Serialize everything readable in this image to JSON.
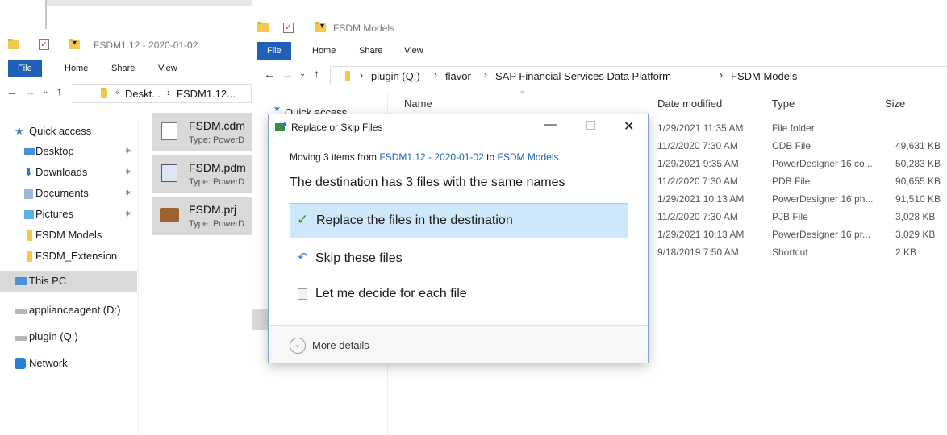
{
  "left_window": {
    "title": "FSDM1.12 - 2020-01-02",
    "tabs": [
      "File",
      "Home",
      "Share",
      "View"
    ],
    "breadcrumb": [
      "Deskt...",
      "FSDM1.12..."
    ],
    "sidebar": {
      "quick_access": "Quick access",
      "items": [
        {
          "label": "Desktop"
        },
        {
          "label": "Downloads"
        },
        {
          "label": "Documents"
        },
        {
          "label": "Pictures"
        },
        {
          "label": "FSDM Models"
        },
        {
          "label": "FSDM_Extension"
        }
      ],
      "this_pc": "This PC",
      "drives": [
        "applianceagent (D:)",
        "plugin (Q:)"
      ],
      "network": "Network"
    },
    "files": [
      {
        "name": "FSDM.cdm",
        "type": "Type: PowerD"
      },
      {
        "name": "FSDM.pdm",
        "type": "Type: PowerD"
      },
      {
        "name": "FSDM.prj",
        "type": "Type: PowerD"
      }
    ]
  },
  "right_window": {
    "title": "FSDM Models",
    "tabs": [
      "File",
      "Home",
      "Share",
      "View"
    ],
    "breadcrumb": [
      "plugin (Q:)",
      "flavor",
      "SAP Financial Services Data Platform",
      "FSDM Models"
    ],
    "quick_access_partial": "Quick access",
    "columns": {
      "name": "Name",
      "date": "Date modified",
      "type": "Type",
      "size": "Size"
    },
    "rows": [
      {
        "date": "1/29/2021 11:35 AM",
        "type": "File folder",
        "size": ""
      },
      {
        "date": "11/2/2020 7:30 AM",
        "type": "CDB File",
        "size": "49,631 KB"
      },
      {
        "date": "1/29/2021 9:35 AM",
        "type": "PowerDesigner 16 co...",
        "size": "50,283 KB"
      },
      {
        "date": "11/2/2020 7:30 AM",
        "type": "PDB File",
        "size": "90,655 KB"
      },
      {
        "date": "1/29/2021 10:13 AM",
        "type": "PowerDesigner 16 ph...",
        "size": "91,510 KB"
      },
      {
        "date": "11/2/2020 7:30 AM",
        "type": "PJB File",
        "size": "3,028 KB"
      },
      {
        "date": "1/29/2021 10:13 AM",
        "type": "PowerDesigner 16 pr...",
        "size": "3,029 KB"
      },
      {
        "date": "9/18/2019 7:50 AM",
        "type": "Shortcut",
        "size": "2 KB"
      }
    ]
  },
  "dialog": {
    "title": "Replace or Skip Files",
    "moving_prefix": "Moving 3 items from",
    "source": "FSDM1.12 - 2020-01-02",
    "to_word": "to",
    "destination": "FSDM Models",
    "heading": "The destination has 3 files with the same names",
    "options": {
      "replace": "Replace the files in the destination",
      "skip": "Skip these files",
      "decide": "Let me decide for each file"
    },
    "more_details": "More details"
  },
  "colors": {
    "accent": "#1f5fb8",
    "link": "#1a64b5",
    "selected": "#cde8fa"
  }
}
